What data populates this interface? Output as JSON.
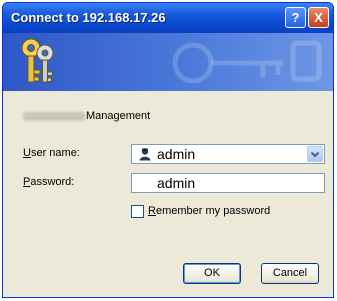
{
  "window": {
    "title": "Connect to 192.168.17.26",
    "help_label": "?",
    "close_label": "X"
  },
  "dialog": {
    "realm": "Management",
    "username": {
      "label_prefix": "",
      "label_access_key": "U",
      "label_rest": "ser name:",
      "value": "admin"
    },
    "password": {
      "label_access_key": "P",
      "label_rest": "assword:",
      "value": "admin"
    },
    "remember": {
      "label_access_key": "R",
      "label_rest": "emember my password",
      "checked": false
    },
    "buttons": {
      "ok": "OK",
      "cancel": "Cancel"
    }
  },
  "colors": {
    "titlebar": "#0a4ad0",
    "banner": "#4b79da",
    "dialog_bg": "#ece9d8",
    "field_border": "#7f9db9"
  }
}
